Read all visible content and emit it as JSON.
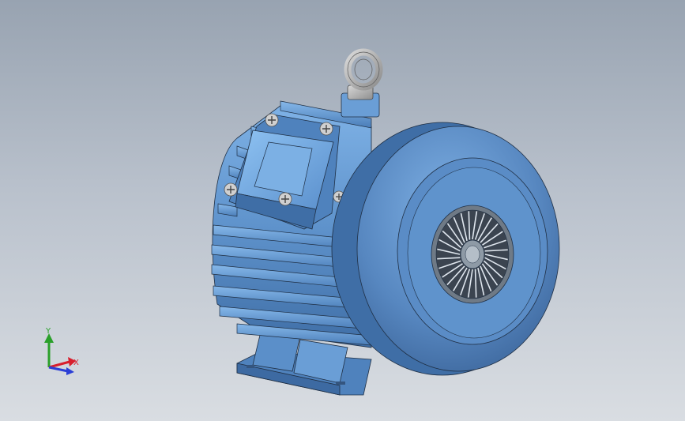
{
  "viewport": {
    "background_top": "#98a3b1",
    "background_bottom": "#d9dde2"
  },
  "model": {
    "part_color": "#5b8fc9",
    "edge_color": "#1f2f44",
    "eyebolt_color": "#a9a9a9",
    "fan_grille_color": "#5c6670",
    "fan_grille_spokes": 28
  },
  "triad": {
    "x_label": "X",
    "y_label": "Y",
    "x_color": "#d81e2c",
    "y_color": "#2aa02a",
    "z_color": "#2b3fd6"
  }
}
